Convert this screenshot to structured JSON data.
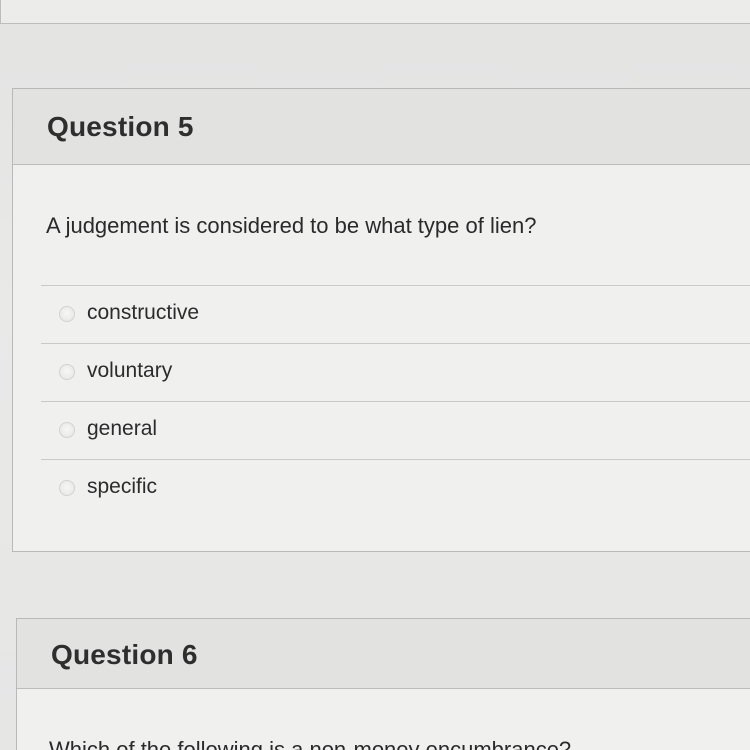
{
  "question5": {
    "title": "Question 5",
    "prompt": "A judgement is considered to be what type of lien?",
    "options": [
      {
        "label": "constructive"
      },
      {
        "label": "voluntary"
      },
      {
        "label": "general"
      },
      {
        "label": "specific"
      }
    ]
  },
  "question6": {
    "title": "Question 6",
    "prompt": "Which of the following is a non-money encumbrance?"
  },
  "colors": {
    "background": "#e7e7e6",
    "card": "#f0f0ef",
    "header": "#e2e2e1",
    "text": "#2b2b2b"
  },
  "icons": {
    "option": "radio-button-icon"
  }
}
